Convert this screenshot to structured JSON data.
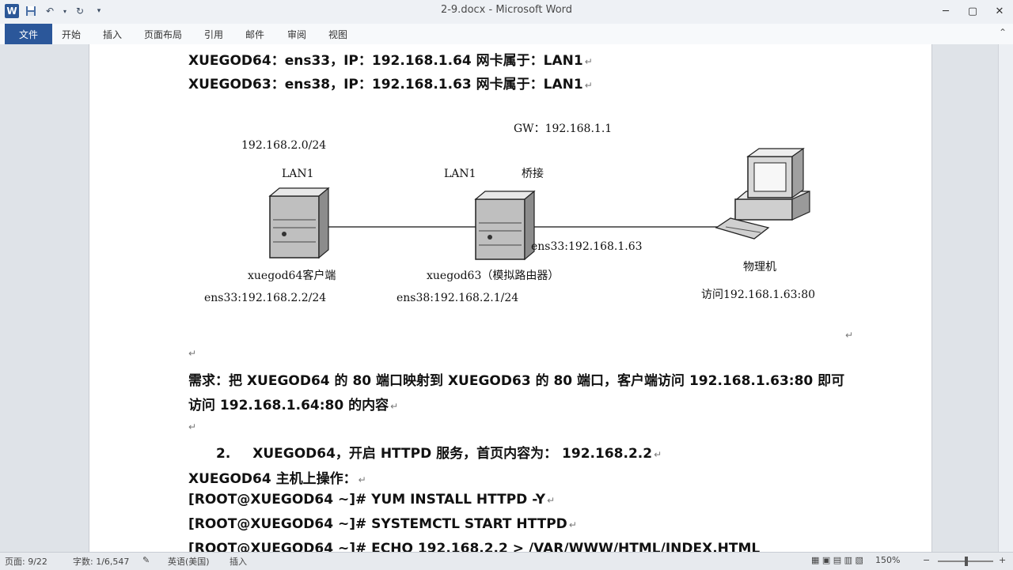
{
  "window": {
    "title": "2-9.docx - Microsoft Word",
    "app_icon_letter": "W"
  },
  "ribbon": {
    "file_tab": "文件",
    "tabs": [
      "开始",
      "插入",
      "页面布局",
      "引用",
      "邮件",
      "审阅",
      "视图"
    ]
  },
  "document": {
    "lines": [
      {
        "text": "XUEGOD64：ens33，IP：192.168.1.64        网卡属于：LAN1"
      },
      {
        "text": "XUEGOD63：ens38，IP：192.168.1.63        网卡属于：LAN1"
      }
    ],
    "diagram": {
      "gw": "GW：192.168.1.1",
      "subnet": "192.168.2.0/24",
      "lan1_left": "LAN1",
      "lan1_mid": "LAN1",
      "bridge": "桥接",
      "router_ens33": "ens33:192.168.1.63",
      "client_name": "xuegod64客户端",
      "router_name": "xuegod63（模拟路由器）",
      "pc_name": "物理机",
      "client_ip": "ens33:192.168.2.2/24",
      "router_ip": "ens38:192.168.2.1/24",
      "pc_access": "访问192.168.1.63:80"
    },
    "requirement_line1": "需求：把 XUEGOD64 的 80 端口映射到 XUEGOD63 的 80 端口，客户端访问 192.168.1.63:80  即可",
    "requirement_line2": "访问 192.168.1.64:80 的内容",
    "step_number": "2.",
    "step_text": "XUEGOD64，开启 HTTPD 服务，首页内容为：  192.168.2.2",
    "host_ops": "XUEGOD64 主机上操作：",
    "cmd1": "[ROOT@XUEGOD64 ~]# YUM INSTALL  HTTPD  -Y",
    "cmd2": "[ROOT@XUEGOD64 ~]# SYSTEMCTL  START  HTTPD",
    "cmd3": "[ROOT@XUEGOD64 ~]# ECHO 192.168.2.2  > /VAR/WWW/HTML/INDEX.HTML",
    "para_mark": "↵"
  },
  "statusbar": {
    "page": "页面: 9/22",
    "words": "字数: 1/6,547",
    "lang": "英语(美国)",
    "mode": "插入",
    "zoom": "150%"
  }
}
